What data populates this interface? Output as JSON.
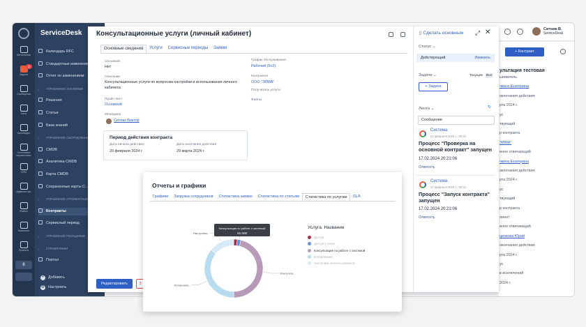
{
  "app": {
    "brand": "ServiceDesk"
  },
  "rail": {
    "items": [
      {
        "name": "rail-item-servicedesk",
        "label": "ServiceDesk",
        "active": false
      },
      {
        "name": "rail-item-tasks",
        "label": "Задачи",
        "active": true,
        "badge": "2"
      },
      {
        "name": "rail-item-messages",
        "label": "Сообщения",
        "active": false
      },
      {
        "name": "rail-item-chats",
        "label": "Чаты",
        "active": false
      },
      {
        "name": "rail-item-calendar",
        "label": "Календарь",
        "active": false
      },
      {
        "name": "rail-item-directory",
        "label": "Системные справочники",
        "active": false
      },
      {
        "name": "rail-item-crm",
        "label": "CRM",
        "active": false
      },
      {
        "name": "rail-item-admin",
        "label": "Администра.",
        "active": false
      },
      {
        "name": "rail-item-files",
        "label": "Файлы",
        "active": false
      },
      {
        "name": "rail-item-company",
        "label": "Компания",
        "active": false
      },
      {
        "name": "rail-item-projects",
        "label": "Проекты",
        "active": false
      }
    ],
    "bottom_badge": "6"
  },
  "nav": {
    "items": [
      {
        "name": "nav-rfc-calendar",
        "label": "Календарь RFC",
        "type": "item"
      },
      {
        "name": "nav-standard-changes",
        "label": "Стандартные изменения",
        "type": "item"
      },
      {
        "name": "nav-change-report",
        "label": "Отчет по изменениям",
        "type": "item"
      },
      {
        "name": "nav-section-knowledge",
        "label": "УПРАВЛЕНИЕ ЗНАНИЯМИ",
        "type": "section"
      },
      {
        "name": "nav-solutions",
        "label": "Решения",
        "type": "item"
      },
      {
        "name": "nav-articles",
        "label": "Статьи",
        "type": "item"
      },
      {
        "name": "nav-knowledge-base",
        "label": "База знаний",
        "type": "item"
      },
      {
        "name": "nav-section-equipment",
        "label": "УПРАВЛЕНИЕ ОБОРУДОВАНИЕМ И КЕ",
        "type": "section"
      },
      {
        "name": "nav-cmdb",
        "label": "CMDB",
        "type": "item"
      },
      {
        "name": "nav-cmdb-analytics",
        "label": "Аналитика CMDB",
        "type": "item"
      },
      {
        "name": "nav-cmdb-map",
        "label": "Карта CMDB",
        "type": "item"
      },
      {
        "name": "nav-saved-maps",
        "label": "Сохраненные карты С...",
        "type": "item"
      },
      {
        "name": "nav-section-cost",
        "label": "УПРАВЛЕНИЕ СТОИМОСТЬЮ УСЛУГ",
        "type": "section"
      },
      {
        "name": "nav-contracts",
        "label": "Контракты",
        "type": "active"
      },
      {
        "name": "nav-service-period",
        "label": "Сервисный период",
        "type": "item"
      },
      {
        "name": "nav-section-relations",
        "label": "УПРАВЛЕНИЕ РЕЛАЦИЯМИ",
        "type": "section"
      },
      {
        "name": "nav-section-directories",
        "label": "СПРАВОЧНИКИ",
        "type": "section"
      },
      {
        "name": "nav-portal",
        "label": "Портал",
        "type": "item"
      }
    ],
    "add_label": "Добавить",
    "settings_label": "Настроить"
  },
  "topbar": {
    "user_name": "Ситник В.",
    "user_org": "ServiceDesk"
  },
  "background": {
    "add_contract": "+ Контракт",
    "title_fragment": "ультация тестовая",
    "lines": [
      {
        "text": "ьзователь",
        "style": "plain"
      },
      {
        "text": "чкина Екатерина",
        "style": "link"
      },
      {
        "text": "окончания действия",
        "style": "plain"
      },
      {
        "text": "рта 2024 г.",
        "style": "plain"
      },
      {
        "text": "ус",
        "style": "plain"
      },
      {
        "text": "твующий",
        "style": "plain"
      },
      {
        "text": "р контракта",
        "style": "plain"
      },
      {
        "text": "ЭЛМА\"",
        "style": "link"
      },
      {
        "text": "енно отвечающий",
        "style": "plain"
      },
      {
        "text": "чкина Екатерина",
        "style": "link"
      },
      {
        "text": "окончания действия",
        "style": "plain"
      },
      {
        "text": "рта 2024 г.",
        "style": "plain"
      },
      {
        "text": "ус",
        "style": "plain"
      },
      {
        "text": "твующий",
        "style": "plain"
      },
      {
        "text": "р контракта",
        "style": "plain"
      },
      {
        "text": "лиент",
        "style": "plain"
      },
      {
        "text": "енно отвечающий",
        "style": "plain"
      },
      {
        "text": "ценкова Юрий",
        "style": "link"
      },
      {
        "text": "окончания действия",
        "style": "plain"
      },
      {
        "text": "рта 2024 г.",
        "style": "plain"
      },
      {
        "text": "ус",
        "style": "plain"
      },
      {
        "text": "в исключений",
        "style": "plain"
      },
      {
        "text": "2024 г.",
        "style": "plain"
      }
    ]
  },
  "modal": {
    "title": "Консультационные услуги (личный кабинет)",
    "tabs": [
      "Основные сведения",
      "Услуги",
      "Сервисные периоды",
      "Заявки"
    ],
    "fields": {
      "main_label": "Основной",
      "main_value": "Нет",
      "desc_label": "Описание",
      "desc_value": "Консультационные услуги по вопросам настройки и использования личного кабинета",
      "price_label": "Прайс-лист",
      "price_value": "Основной",
      "manager_label": "Менеджер",
      "manager_value": "Ситник Виктор",
      "schedule_label": "График обслуживания",
      "schedule_value": "Рабочий (5х2)",
      "contractor_label": "Контрагент",
      "contractor_value": "ООО \"ЭЛМА\"",
      "recipient_label": "Получатель услуги",
      "files_label": "Файлы"
    },
    "period": {
      "title": "Период действия контракта",
      "start_label": "Дата начала действия",
      "start_value": "20 февраля 2024 г.",
      "end_label": "Дата окончания действия",
      "end_value": "29 марта 2024 г."
    },
    "edit_button": "Редактировать",
    "ghost_button": "З",
    "side": {
      "make_main": "Сделать основным",
      "status_label": "Статус",
      "status_value": "Действующий",
      "status_change": "Изменить",
      "tasks_label": "Задачи",
      "filter_current": "Текущие",
      "filter_all": "Все",
      "add_task": "+ Задача",
      "feed_label": "Лента",
      "message_placeholder": "Сообщение",
      "feed": [
        {
          "author": "Система",
          "date": "17 февраля 2024 г., 20:21",
          "message": "Процесс \"Проверка на основной контракт\" запущен",
          "time": "17.02.2024 20:21:06",
          "reply": "Ответить"
        },
        {
          "author": "Система",
          "date": "17 февраля 2024 г., 20:21",
          "message": "Процесс \"Запуск контракта\" запущен",
          "time": "17.02.2024 20:21:06",
          "reply": "Ответить"
        }
      ]
    }
  },
  "reports": {
    "title": "Отчеты и графики",
    "tabs": [
      "Графики",
      "Загрузка сотрудников",
      "Статистика заявок",
      "Статистика по статьям",
      "Статистика по услугам",
      "SLA"
    ],
    "active_tab": 4,
    "tooltip": {
      "label": "Консультация по работе с системой",
      "value": "15 000"
    }
  },
  "chart_data": {
    "type": "pie",
    "donut": true,
    "legend_title": "Услуга. Название",
    "legend_position": "right",
    "slices": [
      {
        "label": "Доступ",
        "short": "Доступ",
        "value": 2,
        "color": "#a3324a"
      },
      {
        "label": "Доступ к папке",
        "short": "Доступ к п...",
        "value": 2,
        "color": "#6b8fd6"
      },
      {
        "label": "Консультация по работе с системой",
        "short": "Консульта...",
        "value": 46,
        "color": "#b79ab8"
      },
      {
        "label": "Копирование",
        "short": "Копирован...",
        "value": 36,
        "color": "#b8dcef"
      },
      {
        "label": "Настройка личного кабинета",
        "short": "Настройка...",
        "value": 14,
        "color": "#d5ebf7"
      }
    ]
  }
}
